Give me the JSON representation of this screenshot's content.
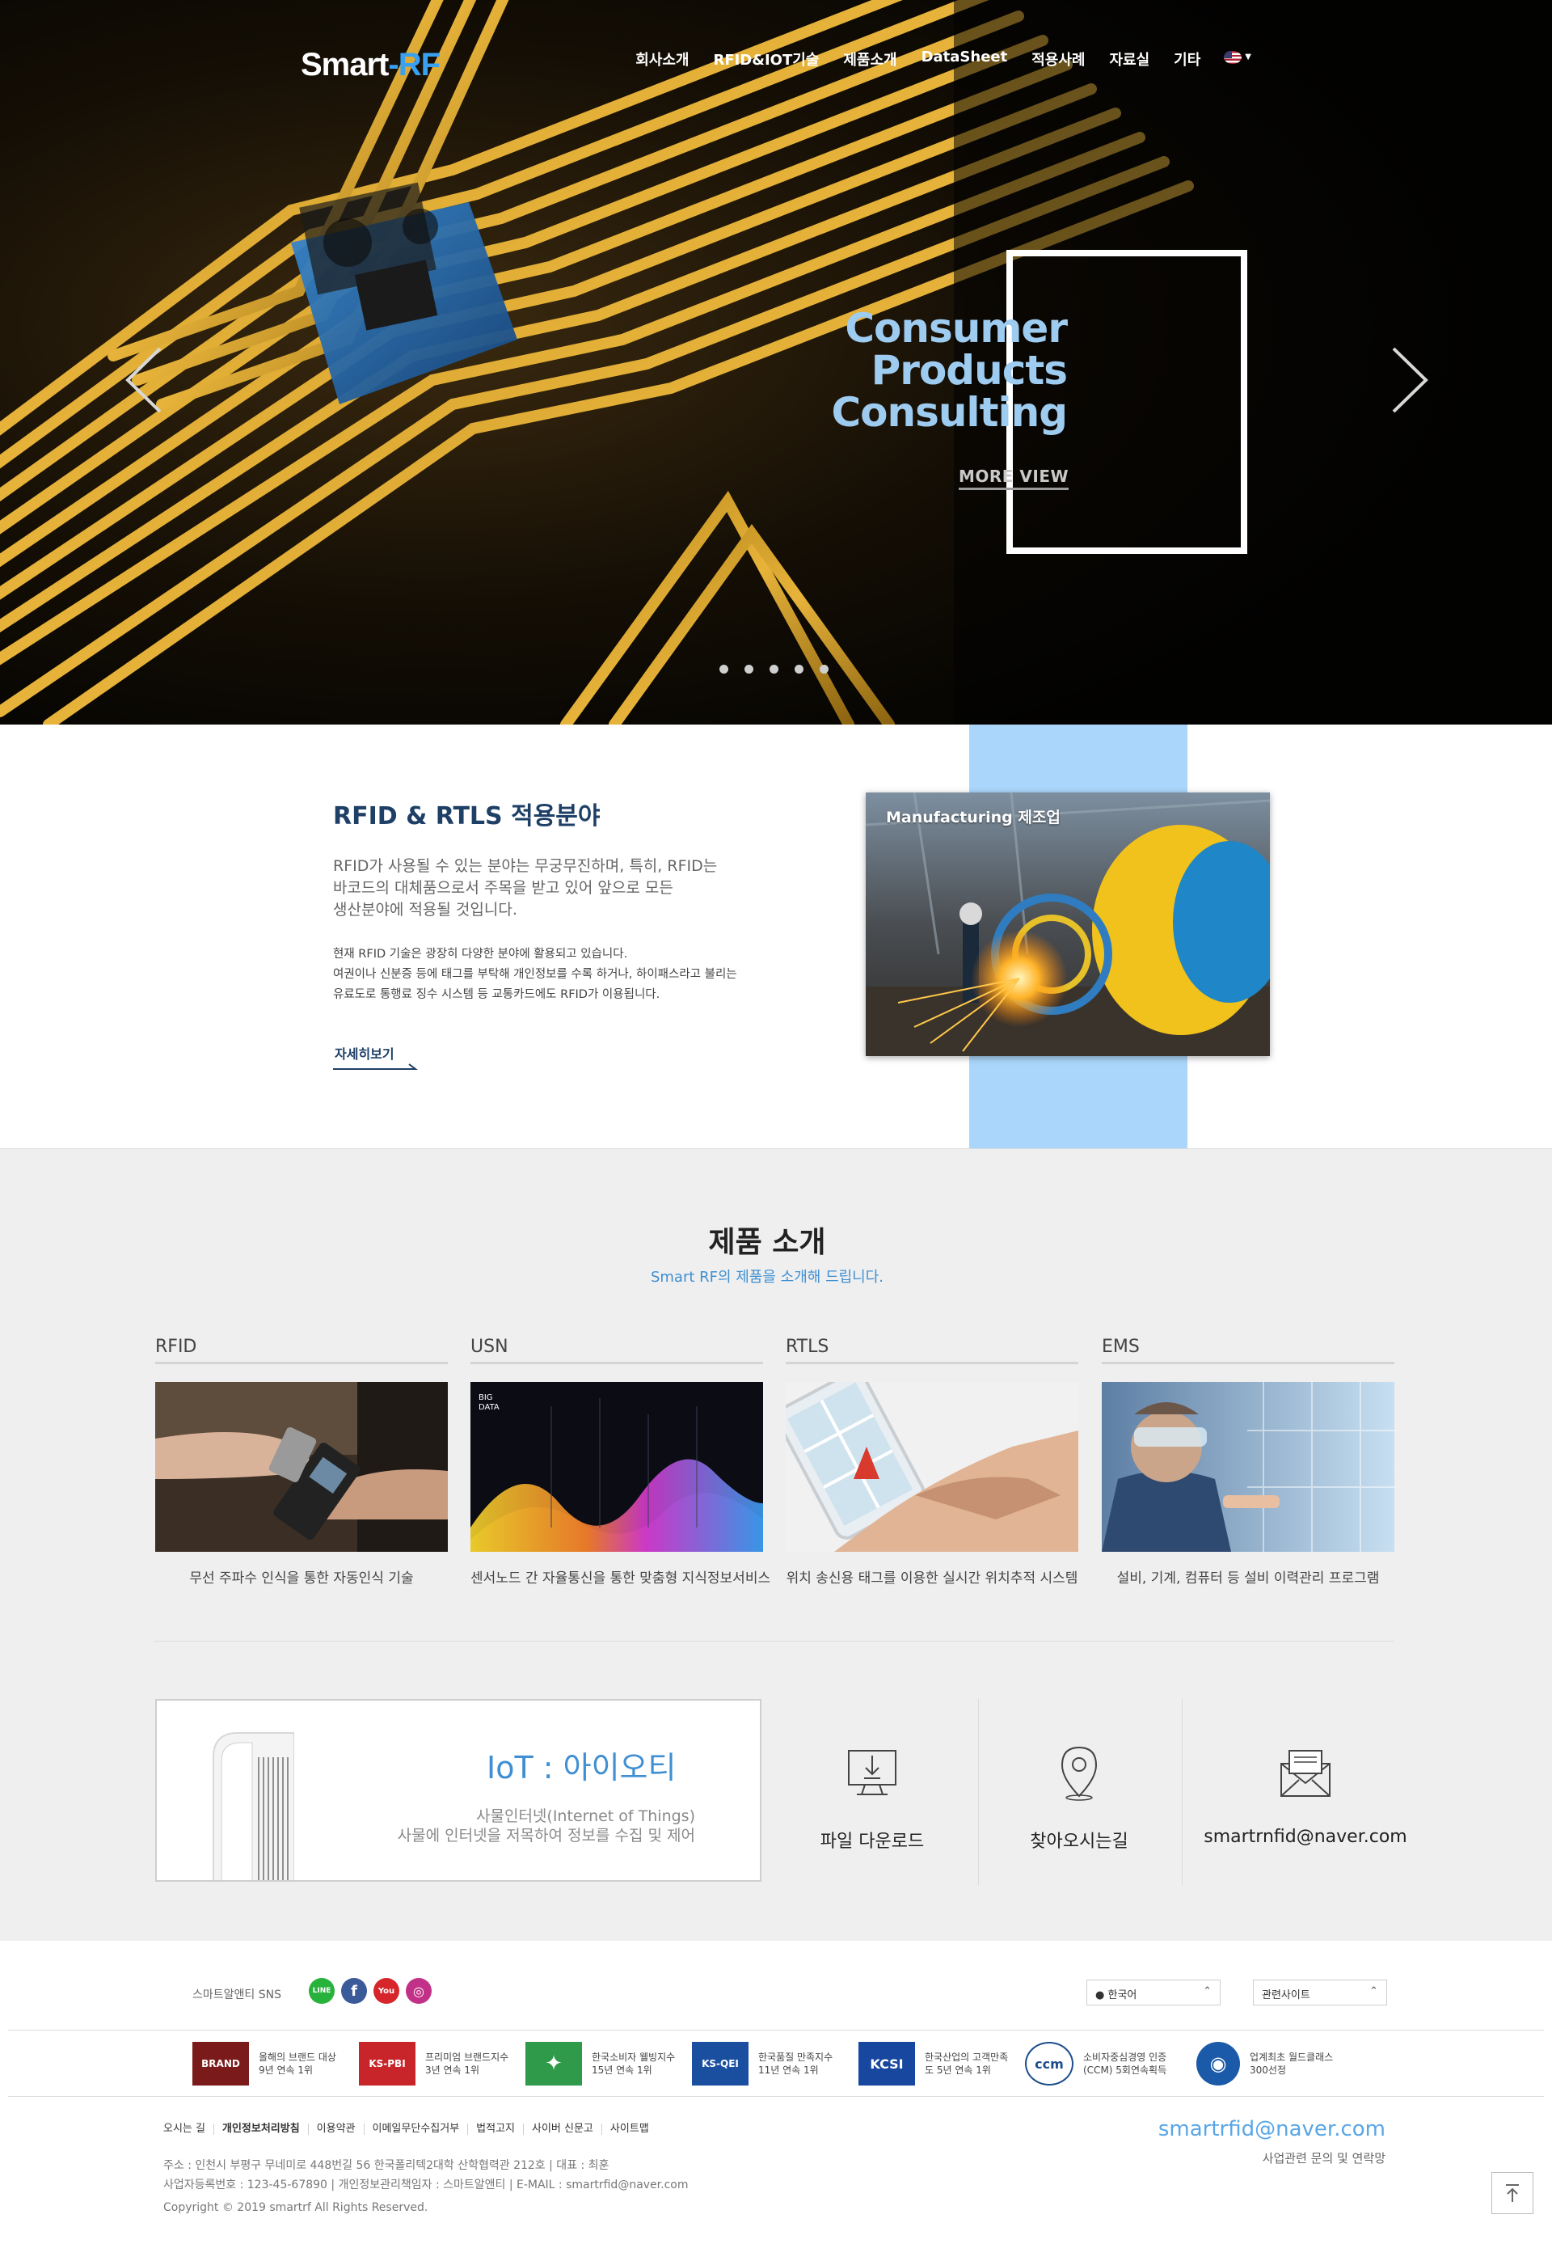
{
  "header": {
    "logo_main": "Smart",
    "logo_dash": "-",
    "logo_accent": "RF",
    "nav": [
      "회사소개",
      "RFID&IOT기술",
      "제품소개",
      "DataSheet",
      "적용사례",
      "자료실",
      "기타"
    ],
    "language_icon": "us-flag-icon"
  },
  "hero": {
    "title_lines": [
      "Consumer",
      "Products",
      "Consulting"
    ],
    "more_label": "MORE VIEW",
    "prev_icon": "chevron-left-icon",
    "next_icon": "chevron-right-icon",
    "slide_count": 5
  },
  "apps": {
    "title": "RFID & RTLS 적용분야",
    "lead_lines": [
      "RFID가 사용될 수 있는 분야는 무궁무진하며, 특히, RFID는",
      "바코드의 대체품으로서 주목을 받고 있어 앞으로 모든",
      "생산분야에 적용될 것입니다."
    ],
    "body_lines": [
      "현재 RFID 기술은 광장히 다양한 분야에 활용되고 있습니다.",
      "여권이나 신분증 등에 태그를 부탁해 개인정보를 수록 하거나, 하이패스라고 불리는",
      "유료도로 통행료 징수 시스템 등 교통카드에도 RFID가 이용됩니다."
    ],
    "more_label": "자세히보기",
    "photo_label": "Manufacturing 제조업",
    "band_color": "#aad6fb"
  },
  "products": {
    "title": "제품 소개",
    "subtitle": "Smart RF의 제품을 소개해 드립니다.",
    "items": [
      {
        "name": "RFID",
        "desc": "무선 주파수 인식을 통한 자동인식 기술"
      },
      {
        "name": "USN",
        "desc": "센서노드 간 자율통신을 통한 맞춤형 지식정보서비스"
      },
      {
        "name": "RTLS",
        "desc": "위치 송신용 태그를 이용한 실시간 위치추적 시스템"
      },
      {
        "name": "EMS",
        "desc": "설비, 기계, 컴퓨터 등 설비 이력관리 프로그램"
      }
    ],
    "usn_overlay": {
      "line1": "BIG",
      "line2": "DATA"
    },
    "iot": {
      "head": "IoT  :  아이오티",
      "line1": "사물인터넷(Internet of Things)",
      "line2": "사물에 인터넷을 저목하여 정보를 수집 및 제어"
    },
    "quick_links": [
      {
        "icon": "download-icon",
        "label": "파일 다운로드"
      },
      {
        "icon": "location-pin-icon",
        "label": "찾아오시는길"
      },
      {
        "icon": "mail-icon",
        "label": "smartrnfid@naver.com"
      }
    ]
  },
  "footer": {
    "sns_label": "스마트알앤티 SNS",
    "sns": [
      {
        "icon": "line-icon",
        "text": "LINE",
        "color": "#27b23b"
      },
      {
        "icon": "facebook-icon",
        "text": "f",
        "color": "#3a5a99"
      },
      {
        "icon": "youtube-icon",
        "text": "You",
        "color": "#d6262c"
      },
      {
        "icon": "instagram-icon",
        "text": "◎",
        "color": "#c23188"
      }
    ],
    "language_select": "한국어",
    "related_select": "관련사이트",
    "awards": [
      {
        "mark": "BRAND",
        "color": "#7b1a1a",
        "line1": "올해의 브랜드 대상",
        "line2": "9년 연속 1위"
      },
      {
        "mark": "KS-PBI",
        "color": "#c8252a",
        "line1": "프리미엄 브랜드지수",
        "line2": "3년 연속 1위"
      },
      {
        "mark": "✦",
        "color": "#2f9a4a",
        "line1": "한국소비자 웰빙지수",
        "line2": "15년 연속 1위"
      },
      {
        "mark": "KS-QEI",
        "color": "#1a4fa0",
        "line1": "한국품질 만족지수",
        "line2": "11년 연속 1위"
      },
      {
        "mark": "KCSI",
        "color": "#17479e",
        "line1": "한국산업의 고객만족",
        "line2": "도 5년 연속 1위"
      },
      {
        "mark": "ccm",
        "color": "#ffffff",
        "line1": "소비자중심경영 인증",
        "line2": "(CCM) 5회연속획득"
      },
      {
        "mark": "◉",
        "color": "#1b5aa8",
        "line1": "업계최초 월드클래스",
        "line2": "300선정"
      }
    ],
    "nav": [
      "오시는 길",
      "개인정보처리방침",
      "이용약관",
      "이메일무단수집거부",
      "법적고지",
      "사이버 신문고",
      "사이트맵"
    ],
    "info_line1": "주소 : 인천시 부평구 무네미로 448번길 56 한국폴리텍2대학 산학협력관 212호  |  대표 : 최훈",
    "info_line2": "사업자등록번호 : 123-45-67890  |  개인정보관리책임자 : 스마트알앤티  |  E-MAIL : smartrfid@naver.com",
    "copyright": "Copyright © 2019 smartrf  All Rights Reserved.",
    "contact_email": "smartrfid@naver.com",
    "contact_sub": "사업관련 문의 및 연락망",
    "totop_icon": "arrow-up-icon"
  }
}
